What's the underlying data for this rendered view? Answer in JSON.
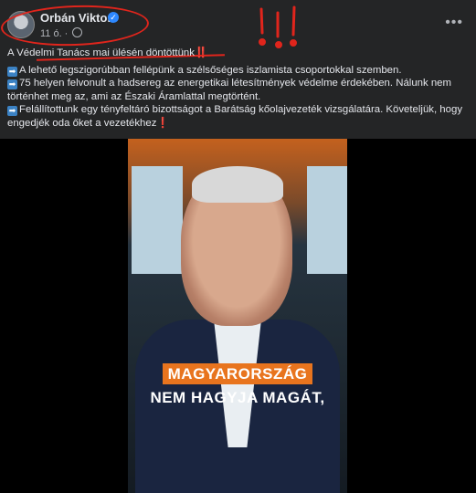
{
  "post": {
    "author": "Orbán Viktor",
    "time": "11 ó.",
    "more_label": "•••",
    "headline": "A Védelmi Tanács mai ülésén döntöttünk",
    "headline_mark": "‼️",
    "paragraphs": [
      "A lehető legszigorúbban fellépünk a szélsőséges iszlamista csoportokkal szemben.",
      "75 helyen felvonult a hadsereg az energetikai létesítmények védelme érdekében. Nálunk nem történhet meg az, ami az Északi Áramlattal megtörtént.",
      "Felállítottunk egy tényfeltáró bizottságot a Barátság kőolajvezeték vizsgálatára. Követeljük, hogy engedjék oda őket a vezetékhez"
    ],
    "last_mark": "❗",
    "arrow_icon": "➡"
  },
  "video": {
    "caption_line1": "MAGYARORSZÁG",
    "caption_line2": "NEM HAGYJA MAGÁT,"
  },
  "annotations": {
    "exclamations": "!!!"
  },
  "colors": {
    "annotation_red": "#e0251c",
    "caption_orange": "#e8741e",
    "verified_blue": "#2d88ff"
  }
}
